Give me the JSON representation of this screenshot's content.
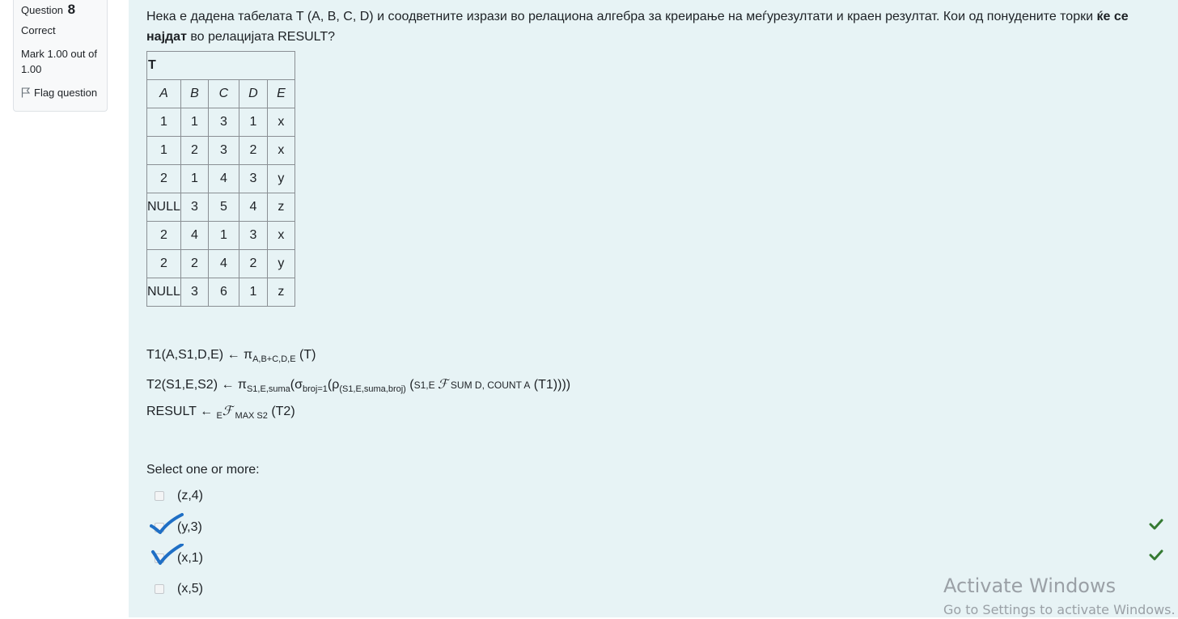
{
  "info": {
    "question_label": "Question",
    "question_number": "8",
    "state": "Correct",
    "grade": "Mark 1.00 out of 1.00",
    "flag_label": "Flag question"
  },
  "question": {
    "text_part1": "Нека е дадена табелата T (A, B, C, D) и соодветните изрази во релациона алгебра за креирање на меѓурезултати и краен резултат. Кои од понудените торки ",
    "text_bold": "ќе се најдат",
    "text_part2": " во релацијата RESULT?"
  },
  "table": {
    "name": "T",
    "headers": [
      "A",
      "B",
      "C",
      "D",
      "E"
    ],
    "rows": [
      [
        "1",
        "1",
        "3",
        "1",
        "x"
      ],
      [
        "1",
        "2",
        "3",
        "2",
        "x"
      ],
      [
        "2",
        "1",
        "4",
        "3",
        "y"
      ],
      [
        "NULL",
        "3",
        "5",
        "4",
        "z"
      ],
      [
        "2",
        "4",
        "1",
        "3",
        "x"
      ],
      [
        "2",
        "2",
        "4",
        "2",
        "y"
      ],
      [
        "NULL",
        "3",
        "6",
        "1",
        "z"
      ]
    ]
  },
  "expressions": {
    "t1_head": "T1(A,S1,D,E) ← π",
    "t1_sub": "A,B+C,D,E",
    "t1_tail": " (T)",
    "t2_head": "T2(S1,E,S2) ← π",
    "t2_sub1": "S1,E,suma",
    "t2_sigma": "(σ",
    "t2_sub2": "broj=1",
    "t2_rho": "(ρ",
    "t2_sub3": "(S1,E,suma,broj)",
    "t2_group": " (",
    "t2_group_small": "S1,E ",
    "t2_f": "ℱ",
    "t2_agg_small": " SUM D, COUNT A",
    "t2_tail": " (T1))))",
    "res_head": "RESULT ← ",
    "res_small": "E",
    "res_f": "ℱ",
    "res_agg_small": " MAX S2",
    "res_tail": " (T2)"
  },
  "answers": {
    "prompt": "Select one or more:",
    "options": [
      {
        "label": "(z,4)",
        "checked": false,
        "correct_mark": false
      },
      {
        "label": "(y,3)",
        "checked": true,
        "correct_mark": true
      },
      {
        "label": "(x,1)",
        "checked": true,
        "correct_mark": true
      },
      {
        "label": "(x,5)",
        "checked": false,
        "correct_mark": false
      }
    ]
  },
  "watermark": {
    "line1": "Activate Windows",
    "line2": "Go to Settings to activate Windows."
  },
  "colors": {
    "content_bg": "#e7f3f5",
    "checkmark_green": "#357a32",
    "pen_blue": "#1f6fc5"
  },
  "icons": {
    "flag": "flag-icon",
    "correct": "checkmark-icon"
  }
}
